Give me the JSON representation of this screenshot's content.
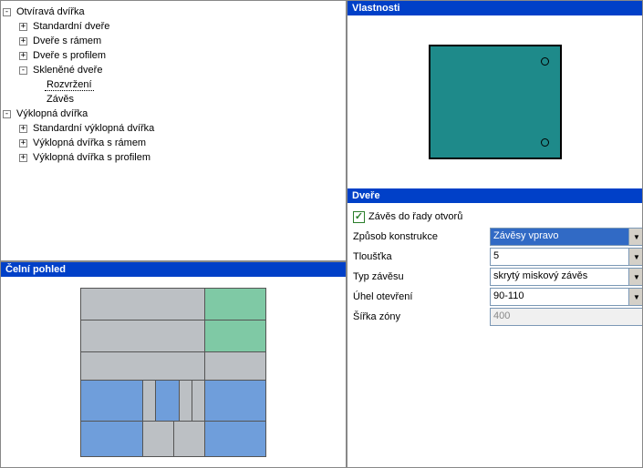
{
  "tree": {
    "root_label": "Otvíravá dvířka",
    "items": [
      {
        "label": "Standardní dveře",
        "toggle": "+"
      },
      {
        "label": "Dveře s rámem",
        "toggle": "+"
      },
      {
        "label": "Dveře s profilem",
        "toggle": "+"
      },
      {
        "label": "Skleněné dveře",
        "toggle": "-"
      }
    ],
    "sklenene_children": [
      {
        "label": "Rozvržení",
        "selected": true
      },
      {
        "label": "Závěs"
      }
    ],
    "root2_label": "Výklopná dvířka",
    "items2": [
      {
        "label": "Standardní výklopná dvířka",
        "toggle": "+"
      },
      {
        "label": "Výklopná dvířka s rámem",
        "toggle": "+"
      },
      {
        "label": "Výklopná dvířka s profilem",
        "toggle": "+"
      }
    ]
  },
  "panels": {
    "properties_title": "Vlastnosti",
    "doors_title": "Dveře",
    "frontview_title": "Čelní pohled"
  },
  "doors": {
    "checkbox_label": "Závěs do řady otvorů",
    "checkbox_checked": "✓",
    "rows": {
      "construction": {
        "label": "Způsob konstrukce",
        "value": "Závěsy vpravo"
      },
      "thickness": {
        "label": "Tloušťka",
        "value": "5"
      },
      "hinge_type": {
        "label": "Typ závěsu",
        "value": "skrytý miskový závěs"
      },
      "open_angle": {
        "label": "Úhel otevření",
        "value": "90-110"
      },
      "zone_width": {
        "label": "Šířka zóny",
        "value": "400"
      }
    }
  }
}
